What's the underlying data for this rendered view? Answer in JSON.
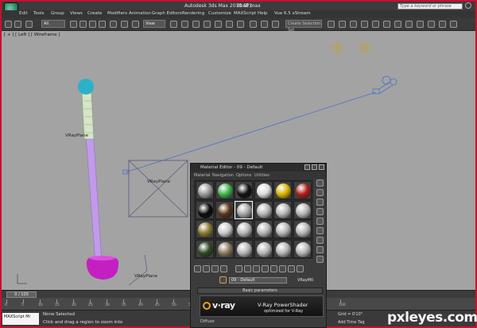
{
  "titlebar": {
    "title": "Autodesk 3ds Max 2010 SP1",
    "file": "8ball.max",
    "search_placeholder": "Type a keyword or phrase"
  },
  "menu": [
    "Edit",
    "Tools",
    "Group",
    "Views",
    "Create",
    "Modifiers",
    "Animation",
    "Graph Editors",
    "Rendering",
    "Customize",
    "MAXScript",
    "Help",
    "Vue 6.5 xStream"
  ],
  "toolbar": {
    "selection_filter": "All",
    "coord_system": "View",
    "named_selection": "Create Selection Set"
  },
  "viewport": {
    "label": "[ + ] [ Left ] [ Wireframe ]",
    "objects": [
      "VRayPlane",
      "VRayPlane",
      "VRayPlane"
    ]
  },
  "timeline": {
    "slider": "0 / 100",
    "ticks": [
      "0",
      "5",
      "10",
      "15",
      "20",
      "25",
      "30",
      "35",
      "40",
      "45",
      "50",
      "55",
      "60",
      "65",
      "70",
      "75",
      "80",
      "85",
      "90",
      "95",
      "100"
    ]
  },
  "status": {
    "maxscript": "MAXScript Mi",
    "selection": "None Selected",
    "prompt": "Click and drag a region to zoom into",
    "grid": "Grid = 0'10\"",
    "add_time_tag": "Add Time Tag"
  },
  "material_editor": {
    "title": "Material Editor - 09 - Default",
    "menu": [
      "Material",
      "Navigation",
      "Options",
      "Utilities"
    ],
    "material_name": "09 - Default",
    "material_type": "VRayMtl",
    "rollout": "Basic parameters",
    "banner_title": "V-Ray PowerShader",
    "banner_sub": "optimized for V-Ray",
    "banner_logo": "v·ray",
    "diffuse_label": "Diffuse",
    "slot_balls": [
      "#9a9a9a",
      "#3fb24a",
      "#111111",
      "#dcdcdc",
      "#d8b400",
      "#b01c1c",
      "#0a0a0a",
      "#5a3418",
      "#a5a5a5",
      "#b5b5b5",
      "#b5b5b5",
      "#b5b5b5",
      "#8a7a30",
      "#c8c8c8",
      "#b5b5b5",
      "#b5b5b5",
      "#b5b5b5",
      "#b5b5b5",
      "#2f4a22",
      "#8a7a60",
      "#b5b5b5",
      "#b5b5b5",
      "#b5b5b5",
      "#b5b5b5"
    ]
  },
  "watermark": "pxleyes.com"
}
